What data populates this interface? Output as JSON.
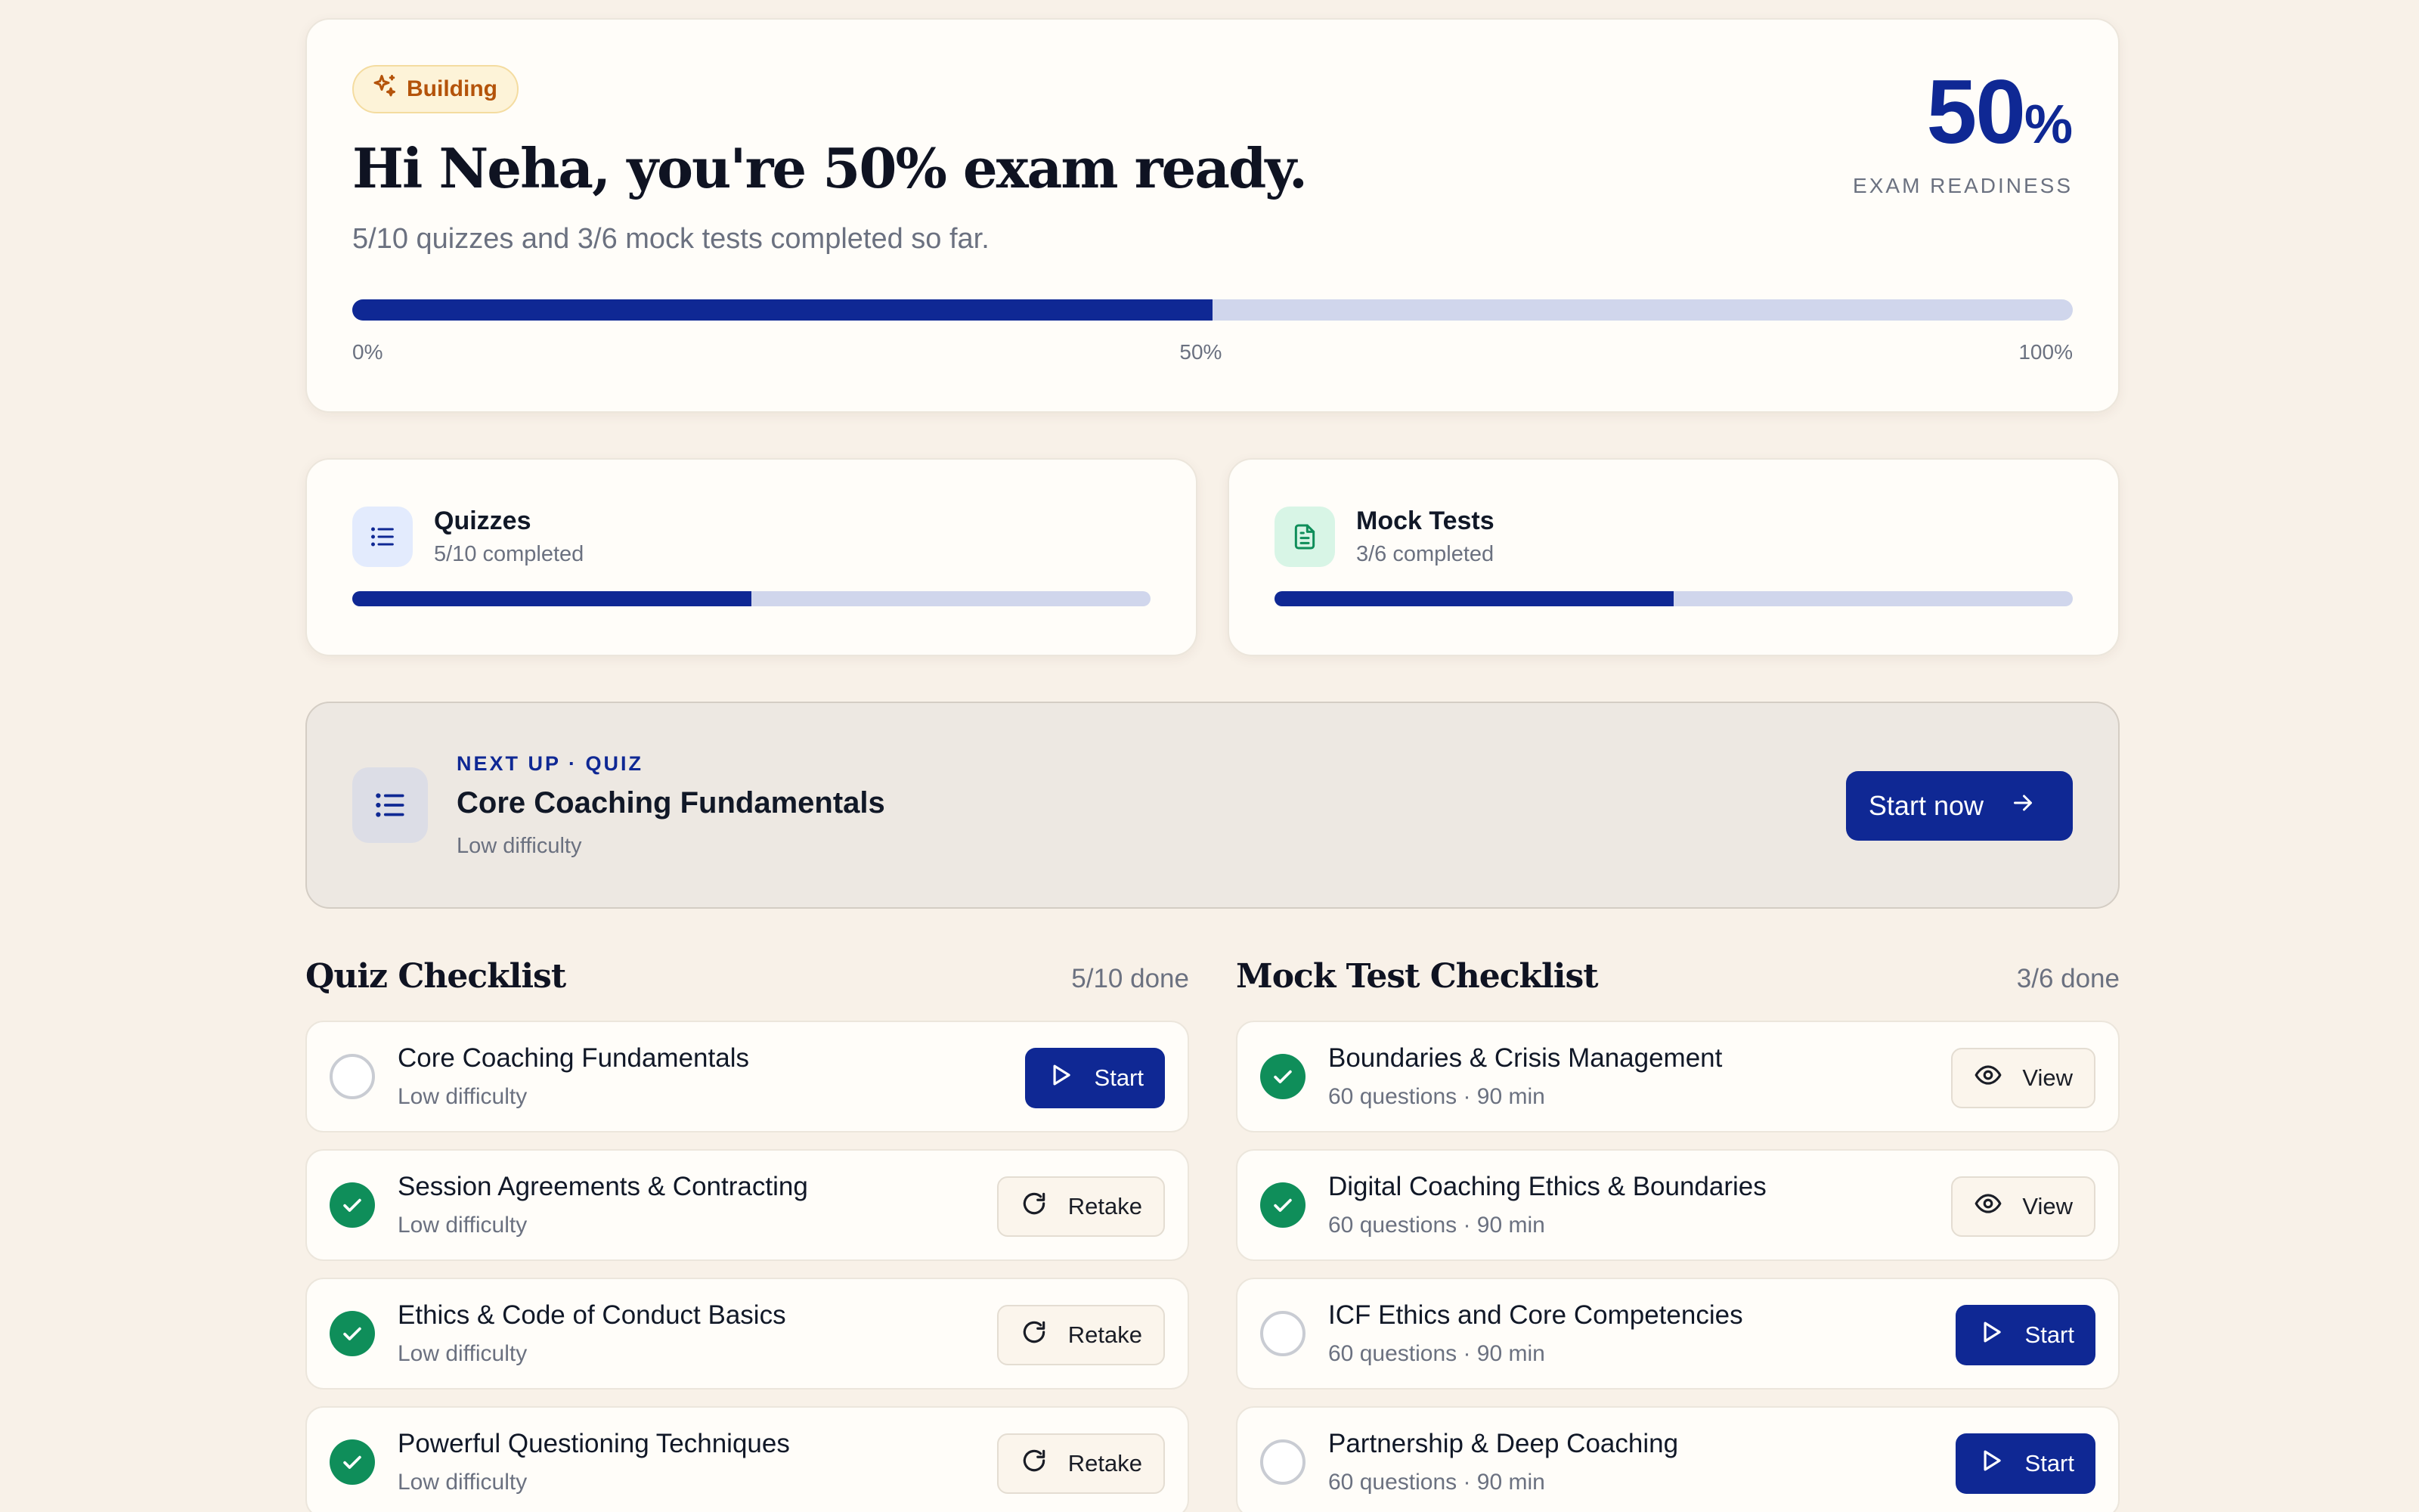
{
  "hero": {
    "badge": "Building",
    "title": "Hi Neha, you're 50% exam ready.",
    "subtitle": "5/10 quizzes and 3/6 mock tests completed so far.",
    "readiness_value": "50",
    "readiness_unit": "%",
    "readiness_label": "EXAM READINESS",
    "progress": 0.5,
    "scale": [
      "0%",
      "50%",
      "100%"
    ]
  },
  "stats": {
    "quizzes": {
      "title": "Quizzes",
      "sub": "5/10 completed",
      "progress": 0.5
    },
    "mocks": {
      "title": "Mock Tests",
      "sub": "3/6 completed",
      "progress": 0.5
    }
  },
  "next_up": {
    "kicker": "NEXT UP · QUIZ",
    "title": "Core Coaching Fundamentals",
    "sub": "Low difficulty",
    "button": "Start now"
  },
  "quiz_checklist": {
    "title": "Quiz Checklist",
    "count": "5/10 done",
    "items": [
      {
        "title": "Core Coaching Fundamentals",
        "sub": "Low difficulty",
        "done": false,
        "action": "Start"
      },
      {
        "title": "Session Agreements & Contracting",
        "sub": "Low difficulty",
        "done": true,
        "action": "Retake"
      },
      {
        "title": "Ethics & Code of Conduct Basics",
        "sub": "Low difficulty",
        "done": true,
        "action": "Retake"
      },
      {
        "title": "Powerful Questioning Techniques",
        "sub": "Low difficulty",
        "done": true,
        "action": "Retake"
      }
    ]
  },
  "mock_checklist": {
    "title": "Mock Test Checklist",
    "count": "3/6 done",
    "items": [
      {
        "title": "Boundaries & Crisis Management",
        "sub": "60 questions · 90 min",
        "done": true,
        "action": "View"
      },
      {
        "title": "Digital Coaching Ethics & Boundaries",
        "sub": "60 questions · 90 min",
        "done": true,
        "action": "View"
      },
      {
        "title": "ICF Ethics and Core Competencies",
        "sub": "60 questions · 90 min",
        "done": false,
        "action": "Start"
      },
      {
        "title": "Partnership & Deep Coaching",
        "sub": "60 questions · 90 min",
        "done": false,
        "action": "Start"
      }
    ]
  },
  "colors": {
    "accent": "#0f2894",
    "success": "#0f8e5a",
    "badge": "#b4530a",
    "background": "#f8f1e8"
  }
}
